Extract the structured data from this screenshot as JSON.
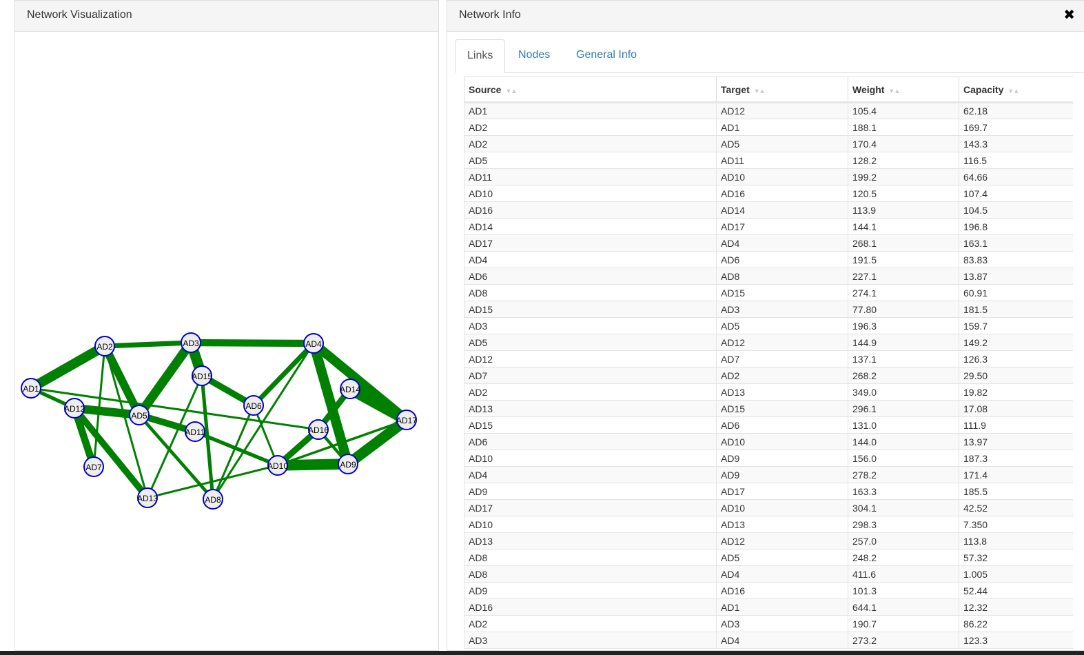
{
  "viz_panel": {
    "title": "Network Visualization"
  },
  "info_panel": {
    "title": "Network Info",
    "close_icon": "close-icon",
    "tabs": [
      {
        "label": "Links",
        "active": true
      },
      {
        "label": "Nodes",
        "active": false
      },
      {
        "label": "General Info",
        "active": false
      }
    ]
  },
  "links_table": {
    "columns": [
      "Source",
      "Target",
      "Weight",
      "Capacity"
    ],
    "rows": [
      [
        "AD1",
        "AD12",
        "105.4",
        "62.18"
      ],
      [
        "AD2",
        "AD1",
        "188.1",
        "169.7"
      ],
      [
        "AD2",
        "AD5",
        "170.4",
        "143.3"
      ],
      [
        "AD5",
        "AD11",
        "128.2",
        "116.5"
      ],
      [
        "AD11",
        "AD10",
        "199.2",
        "64.66"
      ],
      [
        "AD10",
        "AD16",
        "120.5",
        "107.4"
      ],
      [
        "AD16",
        "AD14",
        "113.9",
        "104.5"
      ],
      [
        "AD14",
        "AD17",
        "144.1",
        "196.8"
      ],
      [
        "AD17",
        "AD4",
        "268.1",
        "163.1"
      ],
      [
        "AD4",
        "AD6",
        "191.5",
        "83.83"
      ],
      [
        "AD6",
        "AD8",
        "227.1",
        "13.87"
      ],
      [
        "AD8",
        "AD15",
        "274.1",
        "60.91"
      ],
      [
        "AD15",
        "AD3",
        "77.80",
        "181.5"
      ],
      [
        "AD3",
        "AD5",
        "196.3",
        "159.7"
      ],
      [
        "AD5",
        "AD12",
        "144.9",
        "149.2"
      ],
      [
        "AD12",
        "AD7",
        "137.1",
        "126.3"
      ],
      [
        "AD7",
        "AD2",
        "268.2",
        "29.50"
      ],
      [
        "AD2",
        "AD13",
        "349.0",
        "19.82"
      ],
      [
        "AD13",
        "AD15",
        "296.1",
        "17.08"
      ],
      [
        "AD15",
        "AD6",
        "131.0",
        "111.9"
      ],
      [
        "AD6",
        "AD10",
        "144.0",
        "13.97"
      ],
      [
        "AD10",
        "AD9",
        "156.0",
        "187.3"
      ],
      [
        "AD4",
        "AD9",
        "278.2",
        "171.4"
      ],
      [
        "AD9",
        "AD17",
        "163.3",
        "185.5"
      ],
      [
        "AD17",
        "AD10",
        "304.1",
        "42.52"
      ],
      [
        "AD10",
        "AD13",
        "298.3",
        "7.350"
      ],
      [
        "AD13",
        "AD12",
        "257.0",
        "113.8"
      ],
      [
        "AD8",
        "AD5",
        "248.2",
        "57.32"
      ],
      [
        "AD8",
        "AD4",
        "411.6",
        "1.005"
      ],
      [
        "AD9",
        "AD16",
        "101.3",
        "52.44"
      ],
      [
        "AD16",
        "AD1",
        "644.1",
        "12.32"
      ],
      [
        "AD2",
        "AD3",
        "190.7",
        "86.22"
      ],
      [
        "AD3",
        "AD4",
        "273.2",
        "123.3"
      ]
    ]
  },
  "network": {
    "nodes": [
      "AD1",
      "AD2",
      "AD3",
      "AD4",
      "AD5",
      "AD6",
      "AD7",
      "AD8",
      "AD9",
      "AD10",
      "AD11",
      "AD12",
      "AD13",
      "AD14",
      "AD15",
      "AD16",
      "AD17"
    ],
    "colors": {
      "edge": "#008000",
      "node_fill": "#eeeeee",
      "node_stroke": "#0000cc"
    }
  }
}
